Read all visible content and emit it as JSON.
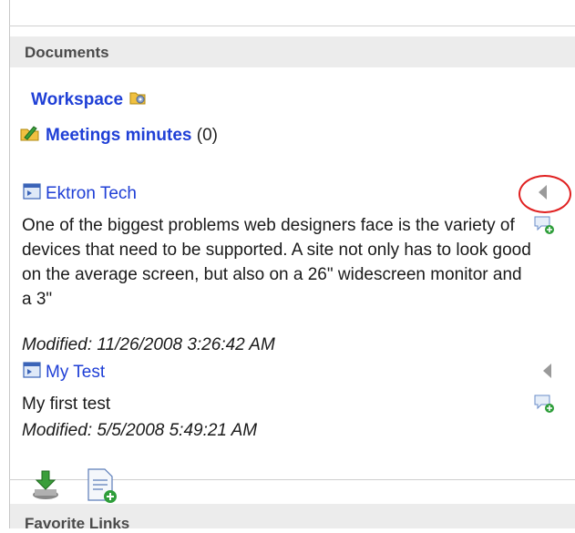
{
  "section": {
    "title": "Documents"
  },
  "folders": [
    {
      "label": "Workspace",
      "count": ""
    },
    {
      "label": "Meetings minutes",
      "count": "(0)"
    }
  ],
  "documents": [
    {
      "title": "Ektron Tech",
      "description": "One of the biggest problems web designers face is the variety of devices that need to be supported. A site not only has to look good on the average screen, but also on a 26\" widescreen monitor and a 3\"",
      "modified": "Modified: 11/26/2008 3:26:42 AM"
    },
    {
      "title": "My Test",
      "description": "My first test",
      "modified": "Modified: 5/5/2008 5:49:21 AM"
    }
  ],
  "footer": {
    "title": "Favorite Links"
  },
  "colors": {
    "link": "#1f3fd6",
    "header_bg": "#ececec",
    "highlight": "#e02020"
  },
  "icons": {
    "workspace": "workspace-folder-icon",
    "meetings": "folder-pencil-icon",
    "document": "document-icon",
    "menu": "triangle-left-icon",
    "comment": "add-comment-icon",
    "download": "download-icon",
    "new_document": "new-document-icon"
  }
}
